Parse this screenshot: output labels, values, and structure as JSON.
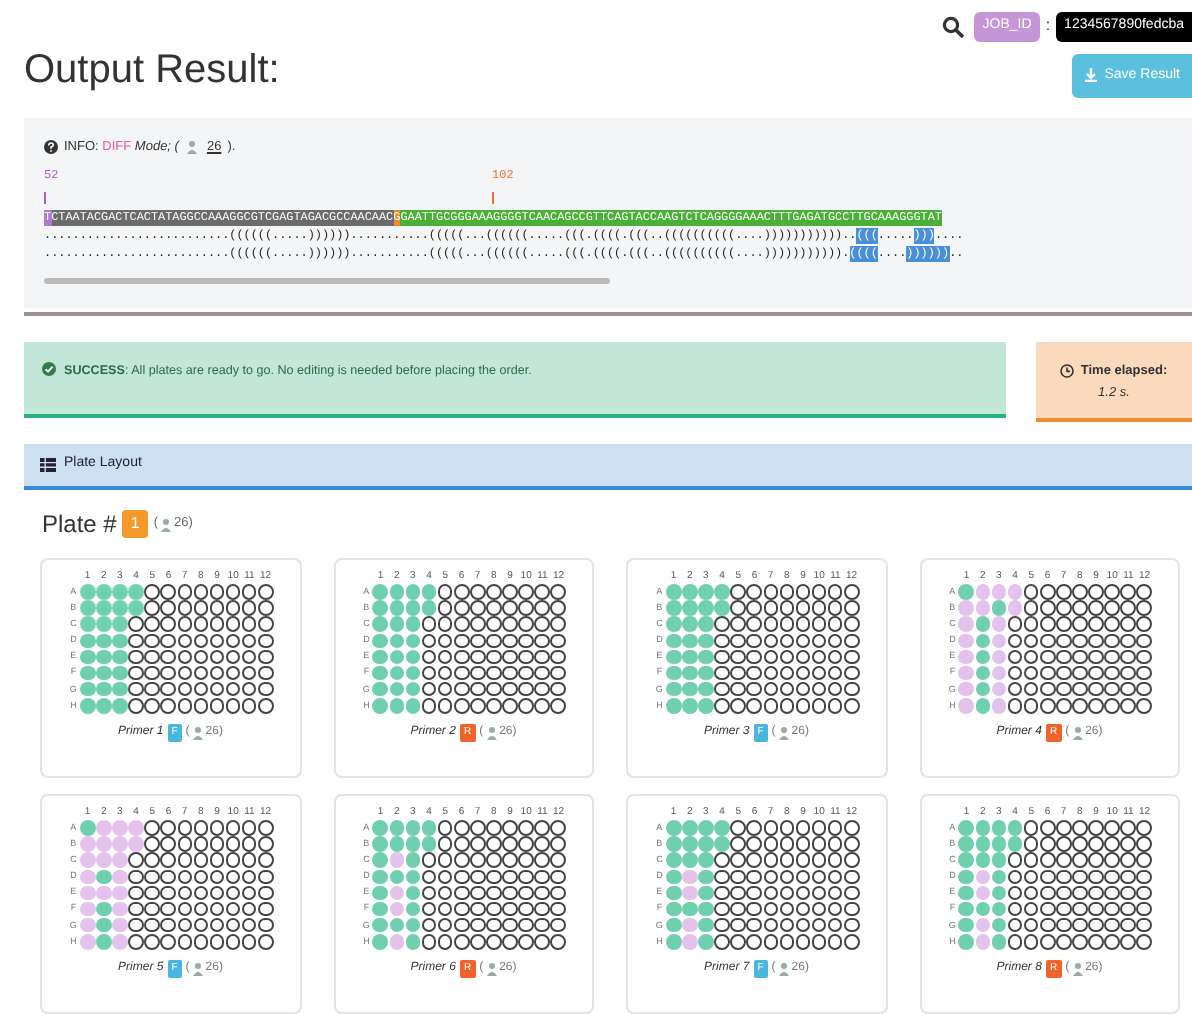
{
  "title": "Output Result:",
  "job": {
    "label": "JOB_ID",
    "separator": ":",
    "value": "1234567890fedcba"
  },
  "save_button": "Save Result",
  "info": {
    "label": "INFO",
    "separator": ":",
    "mode": "DIFF",
    "text": "Mode; (",
    "count": "26",
    "end": ").",
    "markers": [
      {
        "label": "52",
        "color": "#b05cc8"
      },
      {
        "label": "102",
        "color": "#f07030"
      }
    ],
    "sequence": [
      {
        "text": "T",
        "color": "#b07ad0"
      },
      {
        "text": "CTAATACGACTCACTATAGGCCAAAGGCGTCGAGTAGACGCCAACAAC",
        "color": "#6b6b6b"
      },
      {
        "text": "G",
        "color": "#f08a30"
      },
      {
        "text": "GAATTGCGGGAAAGGGGTCAACAGCCGTTCAGTACCAAGTCTCAGGGGAAACTTTGAGATGCCTTGCAAAGGGTAT",
        "color": "#4caf3a"
      }
    ],
    "structures": [
      [
        {
          "text": "..........................((((((.....))))))...........(((((...((((((.....(((.((((.(((..((((((((((....)))))))))))..",
          "highlight": false
        },
        {
          "text": "(((",
          "highlight": true
        },
        {
          "text": ".....",
          "highlight": false
        },
        {
          "text": ")))",
          "highlight": true
        },
        {
          "text": "....",
          "highlight": false
        }
      ],
      [
        {
          "text": "..........................((((((.....))))))...........(((((...((((((.....(((.((((.(((..((((((((((....))))))))))).",
          "highlight": false
        },
        {
          "text": "((((",
          "highlight": true
        },
        {
          "text": "....",
          "highlight": false
        },
        {
          "text": "))))))",
          "highlight": true
        },
        {
          "text": "..",
          "highlight": false
        }
      ]
    ]
  },
  "success": {
    "label": "SUCCESS",
    "text": ": All plates are ready to go. No editing is needed before placing the order."
  },
  "time": {
    "label": "Time elapsed:",
    "value": "1.2 s."
  },
  "plate_layout": {
    "title": "Plate Layout",
    "plate_label": "Plate #",
    "plate_number": "1",
    "count_open": "(",
    "count": "26)",
    "plates": [
      {
        "name": "Primer 1",
        "direction": "F",
        "count_open": "(",
        "count": "26)",
        "columns": [
          "1",
          "2",
          "3",
          "4",
          "5",
          "6",
          "7",
          "8",
          "9",
          "10",
          "11",
          "12"
        ],
        "rows": [
          "A",
          "B",
          "C",
          "D",
          "E",
          "F",
          "G",
          "H"
        ],
        "wells": [
          [
            {
              "color": "#6fcfae"
            },
            {
              "color": "#6fcfae"
            },
            {
              "color": "#6fcfae"
            },
            {
              "color": "#6fcfae"
            }
          ],
          [
            {
              "color": "#6fcfae"
            },
            {
              "color": "#6fcfae"
            },
            {
              "color": "#6fcfae"
            },
            {
              "color": "#6fcfae"
            }
          ],
          [
            {
              "color": "#6fcfae"
            },
            {
              "color": "#6fcfae"
            },
            {
              "color": "#6fcfae"
            }
          ],
          [
            {
              "color": "#6fcfae"
            },
            {
              "color": "#6fcfae"
            },
            {
              "color": "#6fcfae"
            }
          ],
          [
            {
              "color": "#6fcfae"
            },
            {
              "color": "#6fcfae"
            },
            {
              "color": "#6fcfae"
            }
          ],
          [
            {
              "color": "#6fcfae"
            },
            {
              "color": "#6fcfae"
            },
            {
              "color": "#6fcfae"
            }
          ],
          [
            {
              "color": "#6fcfae"
            },
            {
              "color": "#6fcfae"
            },
            {
              "color": "#6fcfae"
            }
          ],
          [
            {
              "color": "#6fcfae"
            },
            {
              "color": "#6fcfae"
            },
            {
              "color": "#6fcfae"
            }
          ]
        ]
      },
      {
        "name": "Primer 2",
        "direction": "R",
        "count_open": "(",
        "count": "26)",
        "columns": [
          "1",
          "2",
          "3",
          "4",
          "5",
          "6",
          "7",
          "8",
          "9",
          "10",
          "11",
          "12"
        ],
        "rows": [
          "A",
          "B",
          "C",
          "D",
          "E",
          "F",
          "G",
          "H"
        ],
        "wells": [
          [
            {
              "color": "#6fcfae"
            },
            {
              "color": "#6fcfae"
            },
            {
              "color": "#6fcfae"
            },
            {
              "color": "#6fcfae"
            }
          ],
          [
            {
              "color": "#6fcfae"
            },
            {
              "color": "#6fcfae"
            },
            {
              "color": "#6fcfae"
            },
            {
              "color": "#6fcfae"
            }
          ],
          [
            {
              "color": "#6fcfae"
            },
            {
              "color": "#6fcfae"
            },
            {
              "color": "#6fcfae"
            }
          ],
          [
            {
              "color": "#6fcfae"
            },
            {
              "color": "#6fcfae"
            },
            {
              "color": "#6fcfae"
            }
          ],
          [
            {
              "color": "#6fcfae"
            },
            {
              "color": "#6fcfae"
            },
            {
              "color": "#6fcfae"
            }
          ],
          [
            {
              "color": "#6fcfae"
            },
            {
              "color": "#6fcfae"
            },
            {
              "color": "#6fcfae"
            }
          ],
          [
            {
              "color": "#6fcfae"
            },
            {
              "color": "#6fcfae"
            },
            {
              "color": "#6fcfae"
            }
          ],
          [
            {
              "color": "#6fcfae"
            },
            {
              "color": "#6fcfae"
            },
            {
              "color": "#6fcfae"
            }
          ]
        ]
      },
      {
        "name": "Primer 3",
        "direction": "F",
        "count_open": "(",
        "count": "26)",
        "columns": [
          "1",
          "2",
          "3",
          "4",
          "5",
          "6",
          "7",
          "8",
          "9",
          "10",
          "11",
          "12"
        ],
        "rows": [
          "A",
          "B",
          "C",
          "D",
          "E",
          "F",
          "G",
          "H"
        ],
        "wells": [
          [
            {
              "color": "#6fcfae"
            },
            {
              "color": "#6fcfae"
            },
            {
              "color": "#6fcfae"
            },
            {
              "color": "#6fcfae"
            }
          ],
          [
            {
              "color": "#6fcfae"
            },
            {
              "color": "#6fcfae"
            },
            {
              "color": "#6fcfae"
            },
            {
              "color": "#6fcfae"
            }
          ],
          [
            {
              "color": "#6fcfae"
            },
            {
              "color": "#6fcfae"
            },
            {
              "color": "#6fcfae"
            }
          ],
          [
            {
              "color": "#6fcfae"
            },
            {
              "color": "#6fcfae"
            },
            {
              "color": "#6fcfae"
            }
          ],
          [
            {
              "color": "#6fcfae"
            },
            {
              "color": "#6fcfae"
            },
            {
              "color": "#6fcfae"
            }
          ],
          [
            {
              "color": "#6fcfae"
            },
            {
              "color": "#6fcfae"
            },
            {
              "color": "#6fcfae"
            }
          ],
          [
            {
              "color": "#6fcfae"
            },
            {
              "color": "#6fcfae"
            },
            {
              "color": "#6fcfae"
            }
          ],
          [
            {
              "color": "#6fcfae"
            },
            {
              "color": "#6fcfae"
            },
            {
              "color": "#6fcfae"
            }
          ]
        ]
      },
      {
        "name": "Primer 4",
        "direction": "R",
        "count_open": "(",
        "count": "26)",
        "columns": [
          "1",
          "2",
          "3",
          "4",
          "5",
          "6",
          "7",
          "8",
          "9",
          "10",
          "11",
          "12"
        ],
        "rows": [
          "A",
          "B",
          "C",
          "D",
          "E",
          "F",
          "G",
          "H"
        ],
        "wells": [
          [
            {
              "color": "#6fcfae"
            },
            {
              "color": "#e3c2ec"
            },
            {
              "color": "#e3c2ec"
            },
            {
              "color": "#e3c2ec"
            }
          ],
          [
            {
              "color": "#e3c2ec"
            },
            {
              "color": "#e3c2ec"
            },
            {
              "color": "#6fcfae"
            },
            {
              "color": "#e3c2ec"
            }
          ],
          [
            {
              "color": "#e3c2ec"
            },
            {
              "color": "#6fcfae"
            },
            {
              "color": "#e3c2ec"
            }
          ],
          [
            {
              "color": "#e3c2ec"
            },
            {
              "color": "#6fcfae"
            },
            {
              "color": "#e3c2ec"
            }
          ],
          [
            {
              "color": "#e3c2ec"
            },
            {
              "color": "#6fcfae"
            },
            {
              "color": "#e3c2ec"
            }
          ],
          [
            {
              "color": "#e3c2ec"
            },
            {
              "color": "#6fcfae"
            },
            {
              "color": "#e3c2ec"
            }
          ],
          [
            {
              "color": "#e3c2ec"
            },
            {
              "color": "#6fcfae"
            },
            {
              "color": "#e3c2ec"
            }
          ],
          [
            {
              "color": "#e3c2ec"
            },
            {
              "color": "#6fcfae"
            },
            {
              "color": "#e3c2ec"
            }
          ]
        ]
      },
      {
        "name": "Primer 5",
        "direction": "F",
        "count_open": "(",
        "count": "26)",
        "columns": [
          "1",
          "2",
          "3",
          "4",
          "5",
          "6",
          "7",
          "8",
          "9",
          "10",
          "11",
          "12"
        ],
        "rows": [
          "A",
          "B",
          "C",
          "D",
          "E",
          "F",
          "G",
          "H"
        ],
        "wells": [
          [
            {
              "color": "#6fcfae"
            },
            {
              "color": "#e3c2ec"
            },
            {
              "color": "#e3c2ec"
            },
            {
              "color": "#e3c2ec"
            }
          ],
          [
            {
              "color": "#e3c2ec"
            },
            {
              "color": "#e3c2ec"
            },
            {
              "color": "#e3c2ec"
            },
            {
              "color": "#e3c2ec"
            }
          ],
          [
            {
              "color": "#e3c2ec"
            },
            {
              "color": "#e3c2ec"
            },
            {
              "color": "#e3c2ec"
            }
          ],
          [
            {
              "color": "#e3c2ec"
            },
            {
              "color": "#6fcfae"
            },
            {
              "color": "#e3c2ec"
            }
          ],
          [
            {
              "color": "#e3c2ec"
            },
            {
              "color": "#e3c2ec"
            },
            {
              "color": "#e3c2ec"
            }
          ],
          [
            {
              "color": "#e3c2ec"
            },
            {
              "color": "#6fcfae"
            },
            {
              "color": "#e3c2ec"
            }
          ],
          [
            {
              "color": "#e3c2ec"
            },
            {
              "color": "#6fcfae"
            },
            {
              "color": "#e3c2ec"
            }
          ],
          [
            {
              "color": "#e3c2ec"
            },
            {
              "color": "#6fcfae"
            },
            {
              "color": "#e3c2ec"
            }
          ]
        ]
      },
      {
        "name": "Primer 6",
        "direction": "R",
        "count_open": "(",
        "count": "26)",
        "columns": [
          "1",
          "2",
          "3",
          "4",
          "5",
          "6",
          "7",
          "8",
          "9",
          "10",
          "11",
          "12"
        ],
        "rows": [
          "A",
          "B",
          "C",
          "D",
          "E",
          "F",
          "G",
          "H"
        ],
        "wells": [
          [
            {
              "color": "#6fcfae"
            },
            {
              "color": "#6fcfae"
            },
            {
              "color": "#6fcfae"
            },
            {
              "color": "#6fcfae"
            }
          ],
          [
            {
              "color": "#6fcfae"
            },
            {
              "color": "#6fcfae"
            },
            {
              "color": "#6fcfae"
            },
            {
              "color": "#6fcfae"
            }
          ],
          [
            {
              "color": "#6fcfae"
            },
            {
              "color": "#e3c2ec"
            },
            {
              "color": "#6fcfae"
            }
          ],
          [
            {
              "color": "#6fcfae"
            },
            {
              "color": "#6fcfae"
            },
            {
              "color": "#6fcfae"
            }
          ],
          [
            {
              "color": "#6fcfae"
            },
            {
              "color": "#e3c2ec"
            },
            {
              "color": "#6fcfae"
            }
          ],
          [
            {
              "color": "#6fcfae"
            },
            {
              "color": "#e3c2ec"
            },
            {
              "color": "#6fcfae"
            }
          ],
          [
            {
              "color": "#6fcfae"
            },
            {
              "color": "#6fcfae"
            },
            {
              "color": "#6fcfae"
            }
          ],
          [
            {
              "color": "#6fcfae"
            },
            {
              "color": "#e3c2ec"
            },
            {
              "color": "#6fcfae"
            }
          ]
        ]
      },
      {
        "name": "Primer 7",
        "direction": "F",
        "count_open": "(",
        "count": "26)",
        "columns": [
          "1",
          "2",
          "3",
          "4",
          "5",
          "6",
          "7",
          "8",
          "9",
          "10",
          "11",
          "12"
        ],
        "rows": [
          "A",
          "B",
          "C",
          "D",
          "E",
          "F",
          "G",
          "H"
        ],
        "wells": [
          [
            {
              "color": "#6fcfae"
            },
            {
              "color": "#6fcfae"
            },
            {
              "color": "#6fcfae"
            },
            {
              "color": "#6fcfae"
            }
          ],
          [
            {
              "color": "#6fcfae"
            },
            {
              "color": "#6fcfae"
            },
            {
              "color": "#6fcfae"
            },
            {
              "color": "#6fcfae"
            }
          ],
          [
            {
              "color": "#6fcfae"
            },
            {
              "color": "#6fcfae"
            },
            {
              "color": "#6fcfae"
            }
          ],
          [
            {
              "color": "#6fcfae"
            },
            {
              "color": "#e3c2ec"
            },
            {
              "color": "#6fcfae"
            }
          ],
          [
            {
              "color": "#6fcfae"
            },
            {
              "color": "#e3c2ec"
            },
            {
              "color": "#6fcfae"
            }
          ],
          [
            {
              "color": "#6fcfae"
            },
            {
              "color": "#6fcfae"
            },
            {
              "color": "#6fcfae"
            }
          ],
          [
            {
              "color": "#6fcfae"
            },
            {
              "color": "#e3c2ec"
            },
            {
              "color": "#6fcfae"
            }
          ],
          [
            {
              "color": "#6fcfae"
            },
            {
              "color": "#e3c2ec"
            },
            {
              "color": "#6fcfae"
            }
          ]
        ]
      },
      {
        "name": "Primer 8",
        "direction": "R",
        "count_open": "(",
        "count": "26)",
        "columns": [
          "1",
          "2",
          "3",
          "4",
          "5",
          "6",
          "7",
          "8",
          "9",
          "10",
          "11",
          "12"
        ],
        "rows": [
          "A",
          "B",
          "C",
          "D",
          "E",
          "F",
          "G",
          "H"
        ],
        "wells": [
          [
            {
              "color": "#6fcfae"
            },
            {
              "color": "#6fcfae"
            },
            {
              "color": "#6fcfae"
            },
            {
              "color": "#6fcfae"
            }
          ],
          [
            {
              "color": "#6fcfae"
            },
            {
              "color": "#6fcfae"
            },
            {
              "color": "#6fcfae"
            },
            {
              "color": "#6fcfae"
            }
          ],
          [
            {
              "color": "#6fcfae"
            },
            {
              "color": "#6fcfae"
            },
            {
              "color": "#6fcfae"
            }
          ],
          [
            {
              "color": "#6fcfae"
            },
            {
              "color": "#e3c2ec"
            },
            {
              "color": "#6fcfae"
            }
          ],
          [
            {
              "color": "#6fcfae"
            },
            {
              "color": "#e3c2ec"
            },
            {
              "color": "#6fcfae"
            }
          ],
          [
            {
              "color": "#6fcfae"
            },
            {
              "color": "#6fcfae"
            },
            {
              "color": "#6fcfae"
            }
          ],
          [
            {
              "color": "#6fcfae"
            },
            {
              "color": "#e3c2ec"
            },
            {
              "color": "#6fcfae"
            }
          ],
          [
            {
              "color": "#6fcfae"
            },
            {
              "color": "#e3c2ec"
            },
            {
              "color": "#6fcfae"
            }
          ]
        ]
      }
    ]
  }
}
